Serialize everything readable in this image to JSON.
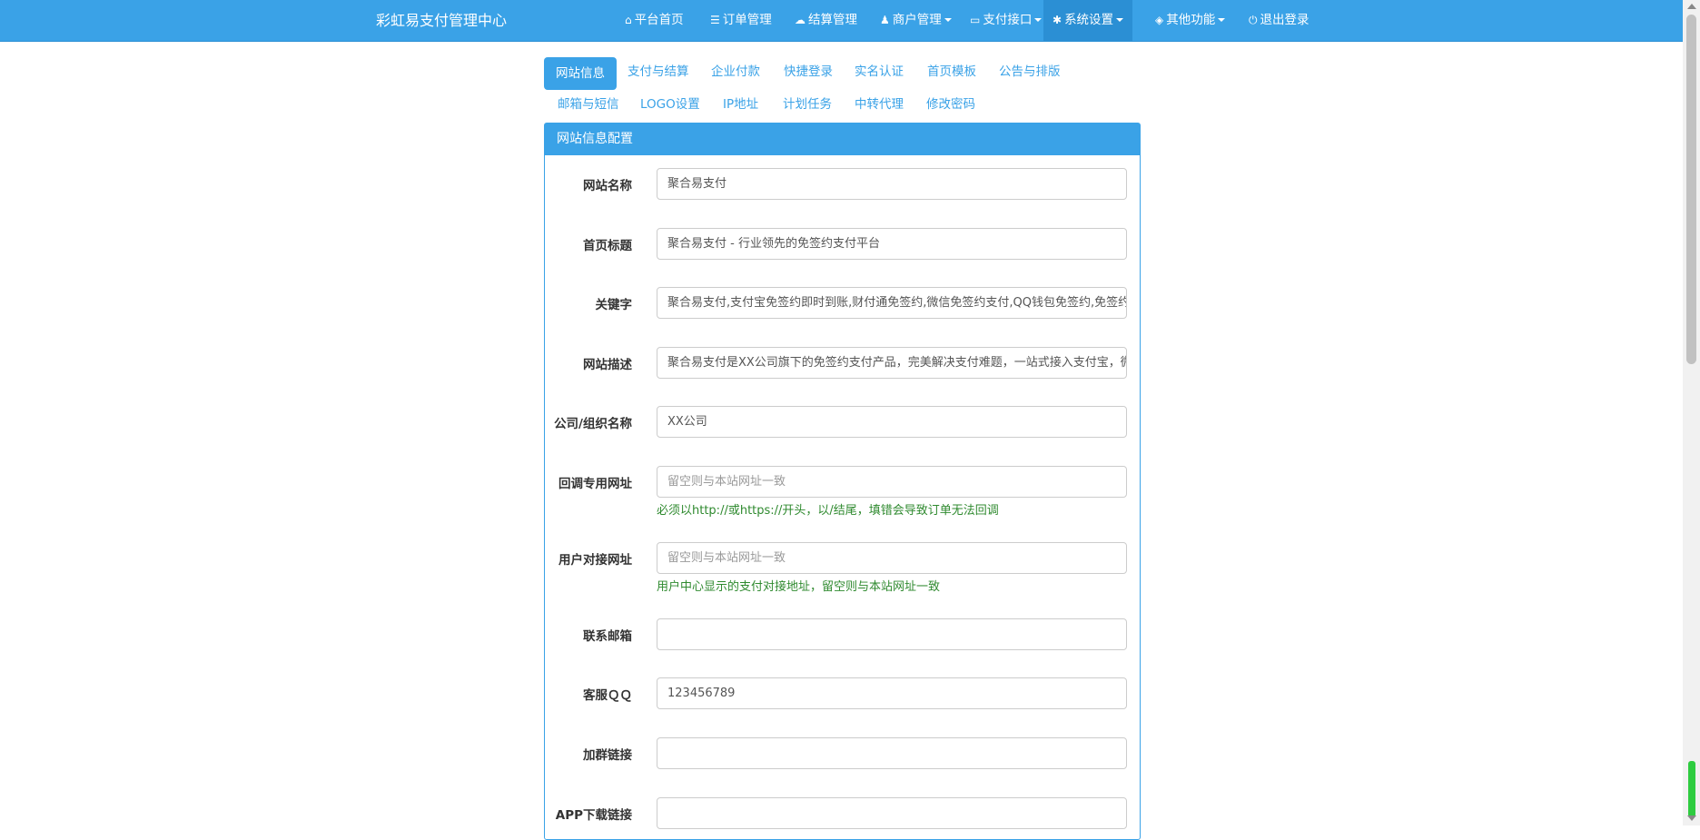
{
  "navbar": {
    "brand": "彩虹易支付管理中心",
    "items": [
      {
        "label": "平台首页",
        "icon": "home-icon",
        "glyph": "⌂",
        "dropdown": false,
        "active": false
      },
      {
        "label": "订单管理",
        "icon": "list-icon",
        "glyph": "☰",
        "dropdown": false,
        "active": false
      },
      {
        "label": "结算管理",
        "icon": "cloud-icon",
        "glyph": "☁",
        "dropdown": false,
        "active": false
      },
      {
        "label": "商户管理",
        "icon": "user-icon",
        "glyph": "♟",
        "dropdown": true,
        "active": false
      },
      {
        "label": "支付接口",
        "icon": "credit-card-icon",
        "glyph": "▭",
        "dropdown": true,
        "active": false
      },
      {
        "label": "系统设置",
        "icon": "gear-icon",
        "glyph": "✱",
        "dropdown": true,
        "active": true
      },
      {
        "label": "其他功能",
        "icon": "cube-icon",
        "glyph": "◈",
        "dropdown": true,
        "active": false
      },
      {
        "label": "退出登录",
        "icon": "power-icon",
        "glyph": "⏻",
        "dropdown": false,
        "active": false
      }
    ]
  },
  "tabs": [
    {
      "label": "网站信息",
      "active": true
    },
    {
      "label": "支付与结算",
      "active": false
    },
    {
      "label": "企业付款",
      "active": false
    },
    {
      "label": "快捷登录",
      "active": false
    },
    {
      "label": "实名认证",
      "active": false
    },
    {
      "label": "首页模板",
      "active": false
    },
    {
      "label": "公告与排版",
      "active": false
    },
    {
      "label": "邮箱与短信",
      "active": false
    },
    {
      "label": "LOGO设置",
      "active": false
    },
    {
      "label": "IP地址",
      "active": false
    },
    {
      "label": "计划任务",
      "active": false
    },
    {
      "label": "中转代理",
      "active": false
    },
    {
      "label": "修改密码",
      "active": false
    }
  ],
  "panel": {
    "title": "网站信息配置",
    "fields": [
      {
        "name": "site-name",
        "label": "网站名称",
        "value": "聚合易支付",
        "placeholder": ""
      },
      {
        "name": "home-title",
        "label": "首页标题",
        "value": "聚合易支付 - 行业领先的免签约支付平台",
        "placeholder": ""
      },
      {
        "name": "keywords",
        "label": "关键字",
        "value": "聚合易支付,支付宝免签约即时到账,财付通免签约,微信免签约支付,QQ钱包免签约,免签约支付",
        "placeholder": ""
      },
      {
        "name": "site-description",
        "label": "网站描述",
        "value": "聚合易支付是XX公司旗下的免签约支付产品，完美解决支付难题，一站式接入支付宝，微信，",
        "placeholder": ""
      },
      {
        "name": "company-name",
        "label": "公司/组织名称",
        "value": "XX公司",
        "placeholder": ""
      },
      {
        "name": "callback-url",
        "label": "回调专用网址",
        "value": "",
        "placeholder": "留空则与本站网址一致",
        "help": "必须以http://或https://开头，以/结尾，填错会导致订单无法回调"
      },
      {
        "name": "user-api-url",
        "label": "用户对接网址",
        "value": "",
        "placeholder": "留空则与本站网址一致",
        "help": "用户中心显示的支付对接地址，留空则与本站网址一致"
      },
      {
        "name": "contact-email",
        "label": "联系邮箱",
        "value": "",
        "placeholder": ""
      },
      {
        "name": "service-qq",
        "label": "客服ＱＱ",
        "value": "123456789",
        "placeholder": ""
      },
      {
        "name": "group-link",
        "label": "加群链接",
        "value": "",
        "placeholder": ""
      },
      {
        "name": "app-download-link",
        "label": "APP下载链接",
        "value": "",
        "placeholder": ""
      }
    ]
  },
  "colors": {
    "accent": "#3aa2e7",
    "help": "#2f8a2f"
  }
}
